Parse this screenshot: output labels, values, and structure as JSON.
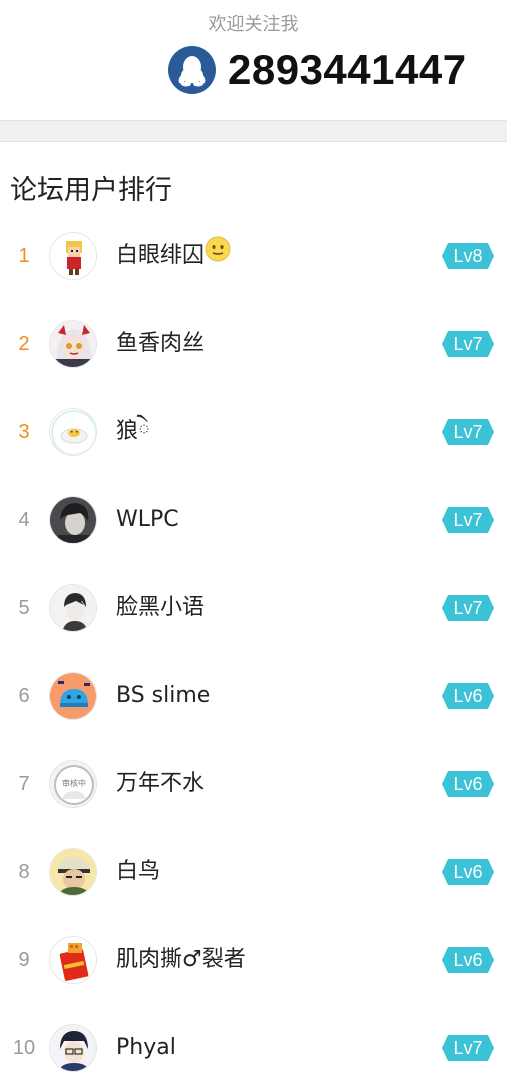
{
  "header": {
    "follow_text": "欢迎关注我",
    "qq_number": "2893441447",
    "qq_icon": "qq-penguin-icon"
  },
  "section": {
    "title": "论坛用户排行"
  },
  "colors": {
    "rank_top": "#f08c22",
    "rank_other": "#9a9a9a",
    "level_badge": "#3cc2d6",
    "qq_blue": "#2b5a9a"
  },
  "ranking": [
    {
      "rank": "1",
      "name": "白眼绯囚",
      "level": "Lv8",
      "avatar": "pixel-character-avatar",
      "emoji": "smiley-emoji"
    },
    {
      "rank": "2",
      "name": "鱼香肉丝",
      "level": "Lv7",
      "avatar": "anime-girl-avatar"
    },
    {
      "rank": "3",
      "name": "狼ེ",
      "level": "Lv7",
      "avatar": "fried-egg-avatar"
    },
    {
      "rank": "4",
      "name": "WLPC",
      "level": "Lv7",
      "avatar": "dark-portrait-avatar"
    },
    {
      "rank": "5",
      "name": "脸黑小语",
      "level": "Lv7",
      "avatar": "sketch-boy-avatar"
    },
    {
      "rank": "6",
      "name": "BS slime",
      "level": "Lv6",
      "avatar": "blue-slime-avatar"
    },
    {
      "rank": "7",
      "name": "万年不水",
      "level": "Lv6",
      "avatar": "reviewing-placeholder-avatar",
      "avatar_text": "审核中"
    },
    {
      "rank": "8",
      "name": "白鸟",
      "level": "Lv6",
      "avatar": "cap-character-avatar"
    },
    {
      "rank": "9",
      "name": "肌肉撕♂裂者",
      "level": "Lv6",
      "avatar": "red-package-avatar"
    },
    {
      "rank": "10",
      "name": "Phyal",
      "level": "Lv7",
      "avatar": "anime-boy-avatar"
    }
  ]
}
